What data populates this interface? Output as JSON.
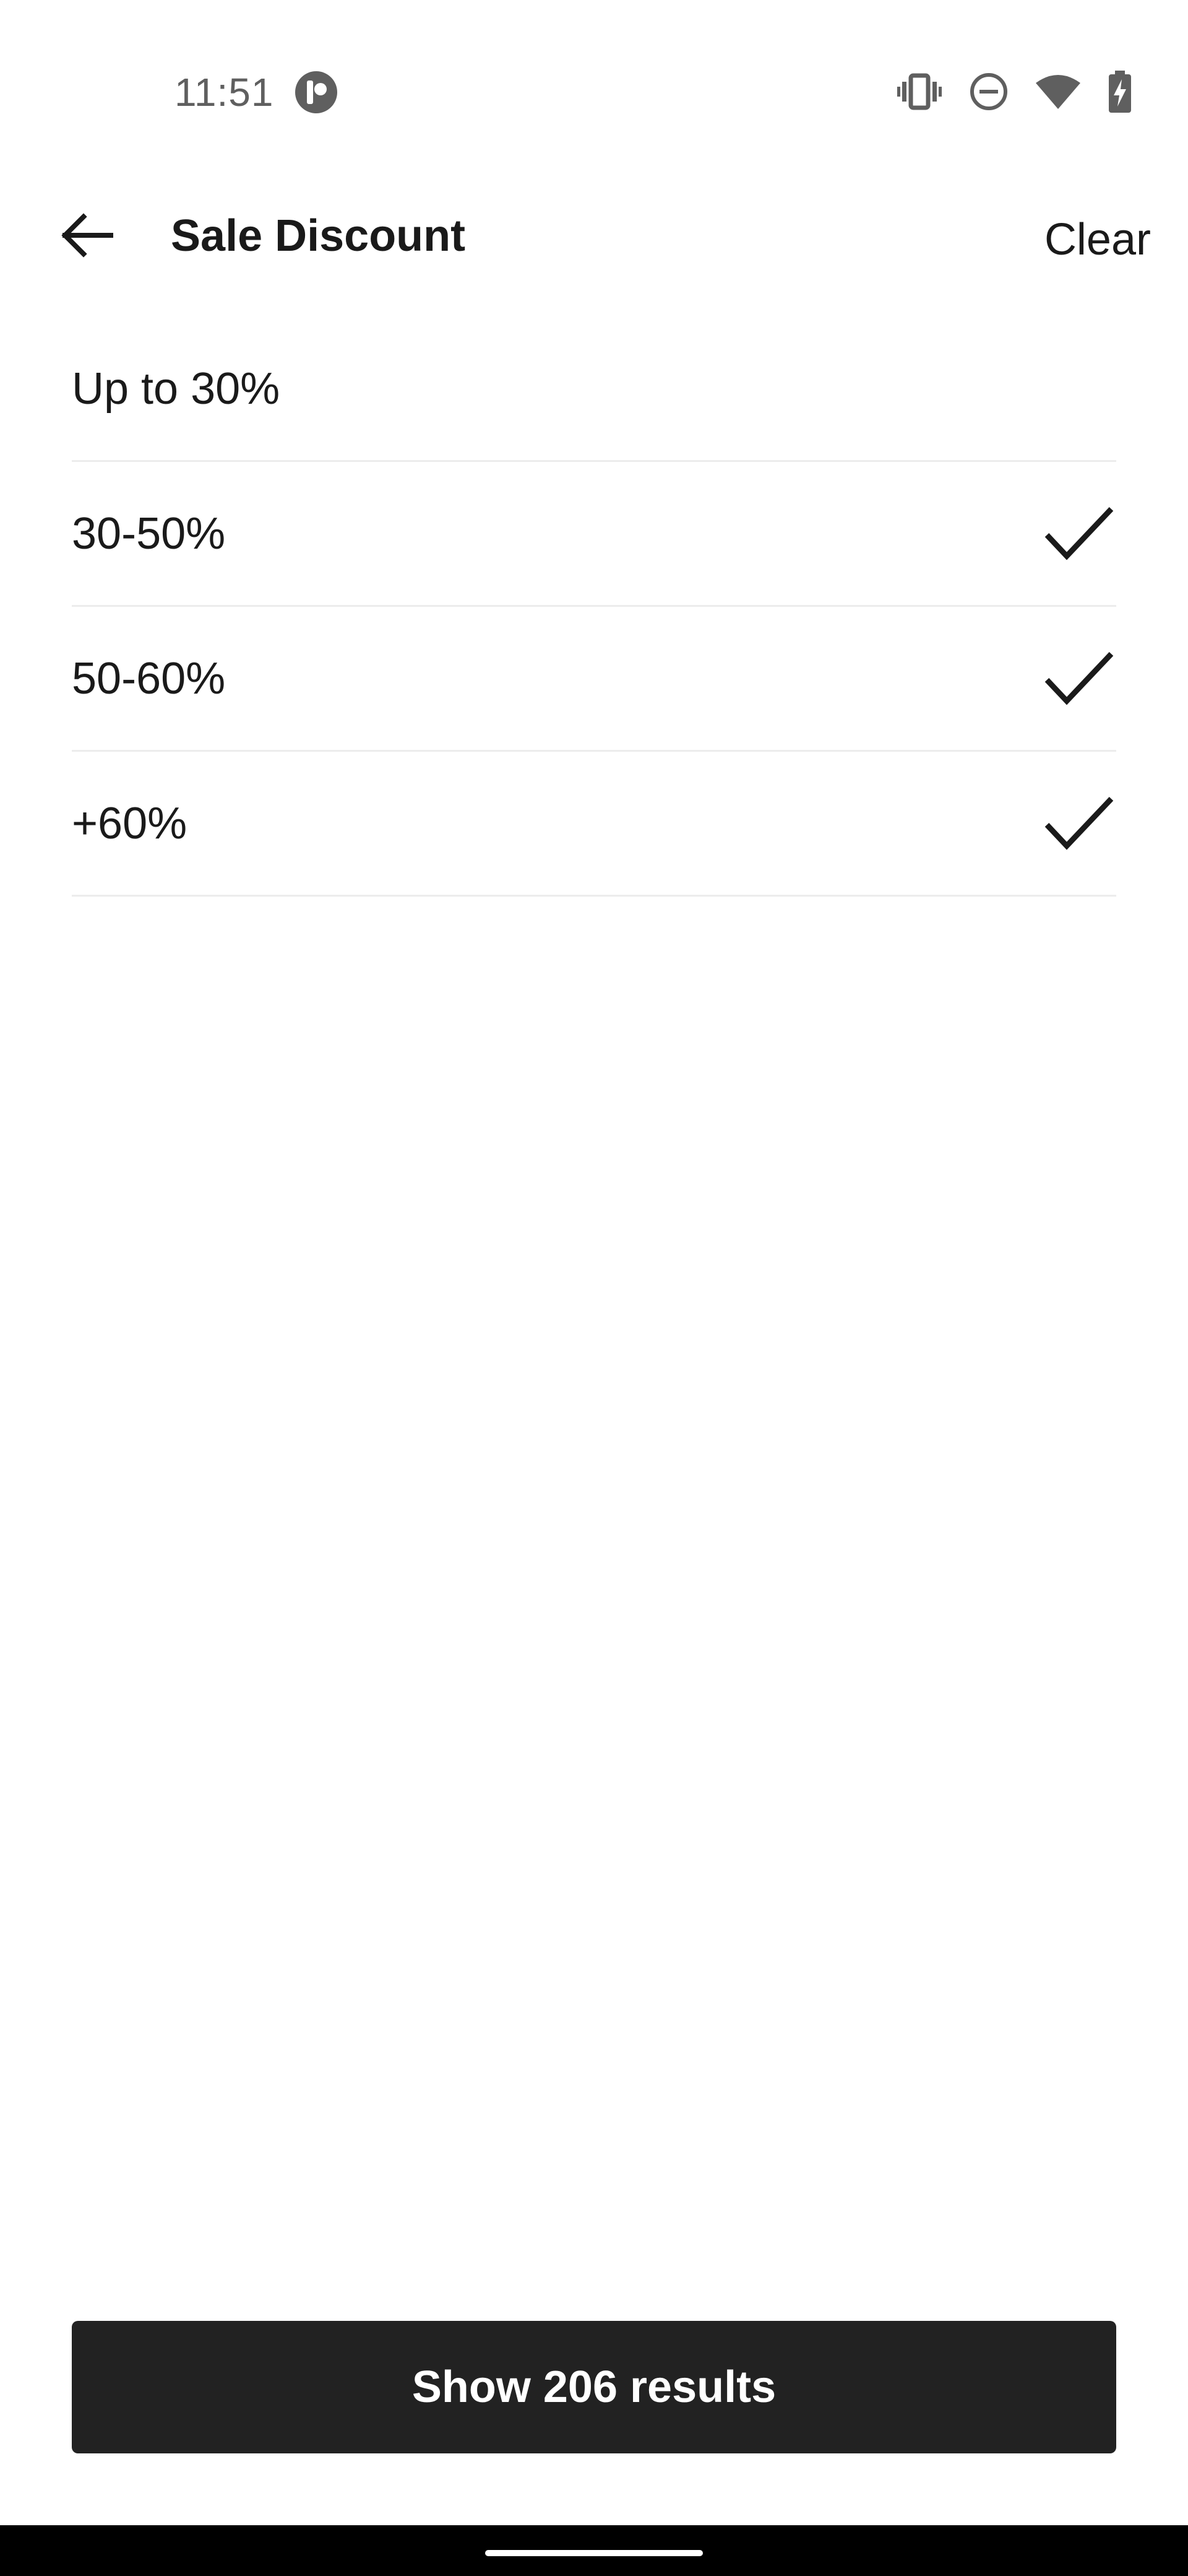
{
  "status_bar": {
    "time": "11:51",
    "app_icon": "app-notification-icon",
    "icons": [
      "vibrate-icon",
      "do-not-disturb-icon",
      "wifi-icon",
      "battery-charging-icon"
    ]
  },
  "header": {
    "back_icon": "arrow-back-icon",
    "title": "Sale Discount",
    "clear_label": "Clear"
  },
  "options": [
    {
      "label": "Up to 30%",
      "selected": false
    },
    {
      "label": "30-50%",
      "selected": true
    },
    {
      "label": "50-60%",
      "selected": true
    },
    {
      "label": "+60%",
      "selected": true
    }
  ],
  "footer": {
    "show_results_label": "Show 206 results"
  },
  "colors": {
    "button_bg": "#222222",
    "button_text": "#ffffff",
    "divider": "#ececec",
    "status_text": "#5f5f5f"
  }
}
